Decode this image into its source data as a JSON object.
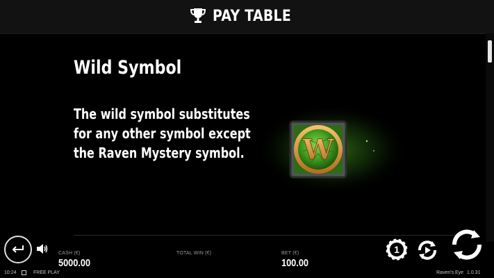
{
  "header": {
    "title": "PAY TABLE",
    "icon": "trophy-icon"
  },
  "content": {
    "section_title": "Wild Symbol",
    "description_lines": [
      "The wild symbol substitutes",
      "for any other symbol except",
      "the Raven Mystery symbol."
    ],
    "symbol_letter": "W"
  },
  "bottom_bar": {
    "cash_label": "CASH (€)",
    "cash_value": "5000.00",
    "total_win_label": "TOTAL WIN (€)",
    "total_win_value": "",
    "bet_label": "BET (€)",
    "bet_value": "100.00",
    "chip_value": "1"
  },
  "status_bar": {
    "time": "10:24",
    "mode": "FREE PLAY",
    "game_name": "Raven's Eye",
    "version": "1.0.31"
  },
  "colors": {
    "background": "#000000",
    "header_bg": "#121212",
    "text": "#ffffff",
    "label": "#9a9a9a",
    "symbol_green": "#3d9a1f",
    "symbol_gold": "#e09a3a"
  }
}
